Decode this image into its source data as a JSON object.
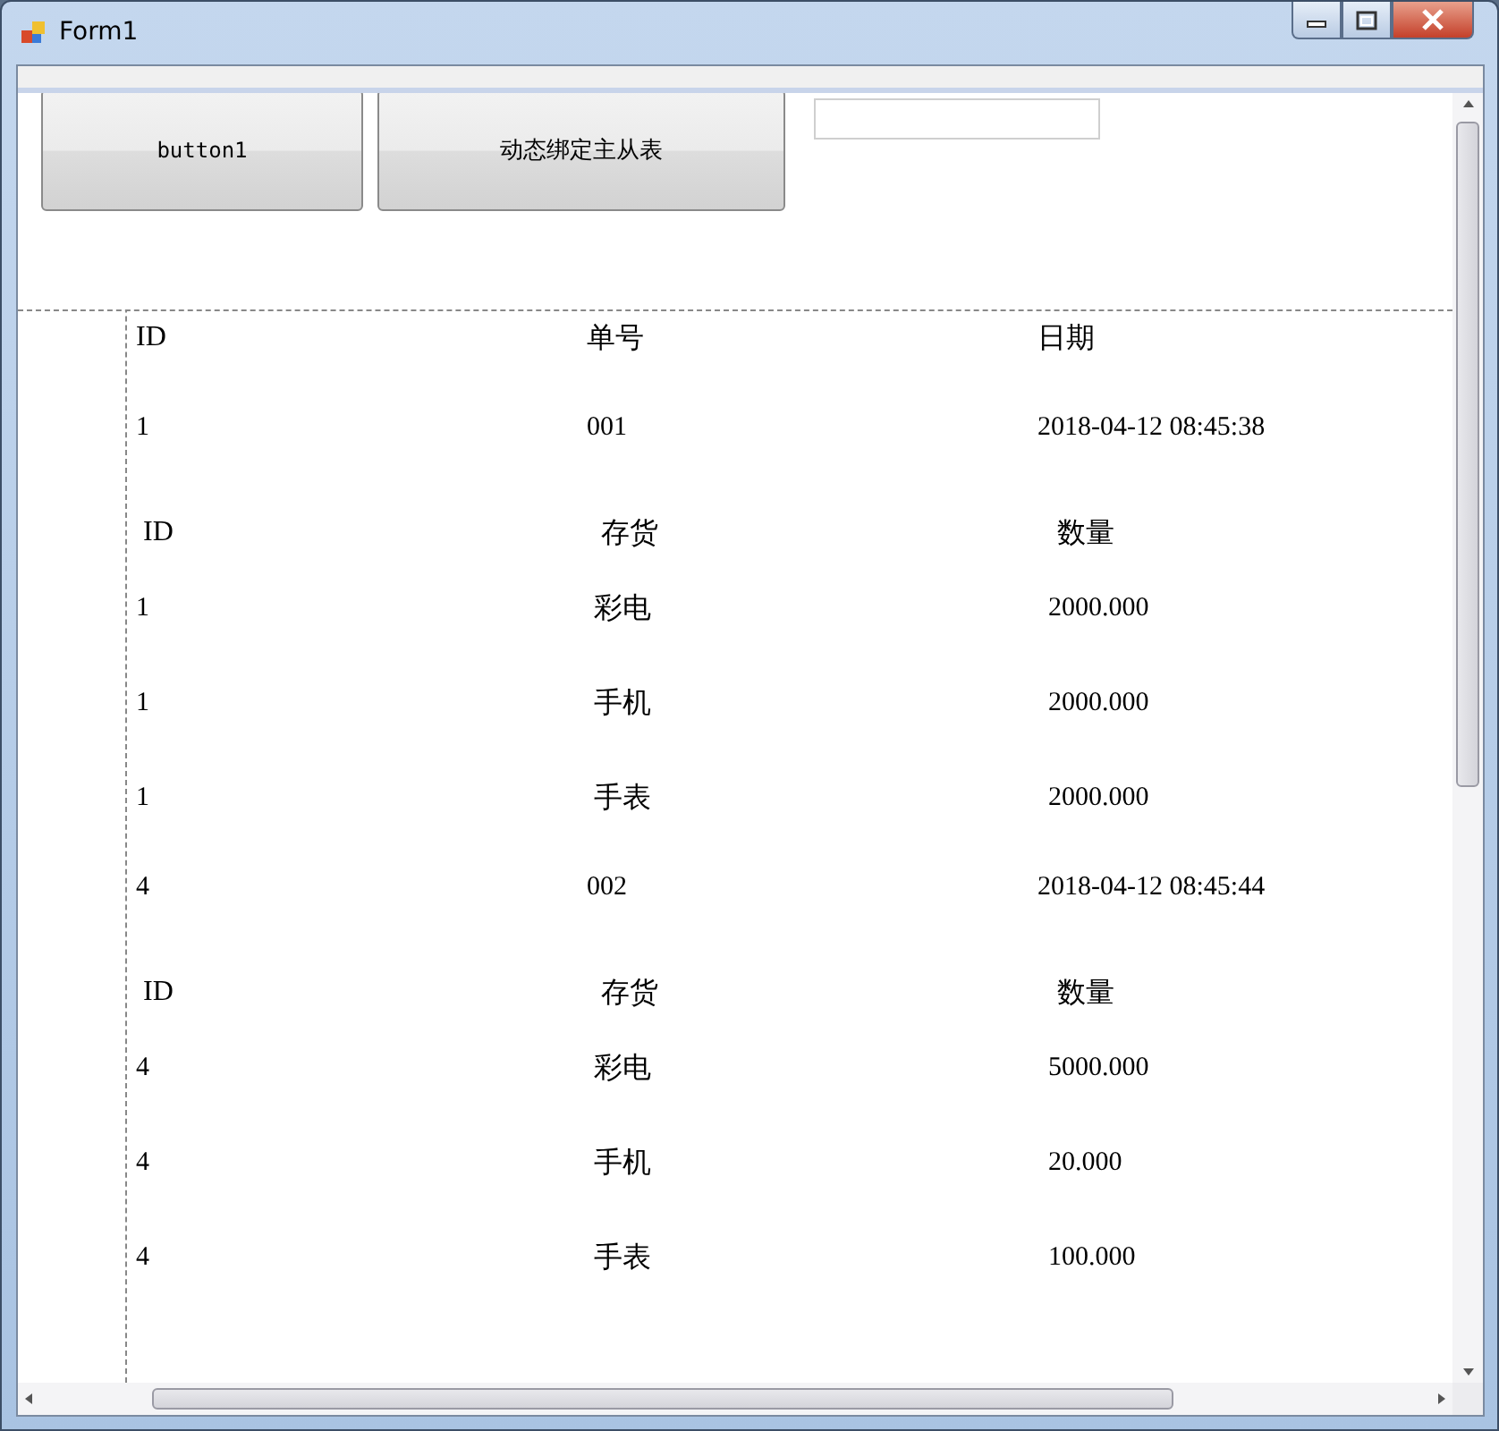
{
  "window": {
    "title": "Form1"
  },
  "buttons": [
    {
      "label": "button1",
      "kind": "mono"
    },
    {
      "label": "动态绑定主从表",
      "kind": "plain"
    }
  ],
  "master": {
    "columns": [
      "ID",
      "单号",
      "日期"
    ]
  },
  "records": [
    {
      "cells": [
        "1",
        "001",
        "2018-04-12 08:45:38"
      ],
      "detail": {
        "columns": [
          "ID",
          "存货",
          "数量"
        ],
        "rows": [
          [
            "1",
            "彩电",
            "2000.000"
          ],
          [
            "1",
            "手机",
            "2000.000"
          ],
          [
            "1",
            "手表",
            "2000.000"
          ]
        ]
      }
    },
    {
      "cells": [
        "4",
        "002",
        "2018-04-12 08:45:44"
      ],
      "detail": {
        "columns": [
          "ID",
          "存货",
          "数量"
        ],
        "rows": [
          [
            "4",
            "彩电",
            "5000.000"
          ],
          [
            "4",
            "手机",
            "20.000"
          ],
          [
            "4",
            "手表",
            "100.000"
          ]
        ]
      }
    }
  ]
}
